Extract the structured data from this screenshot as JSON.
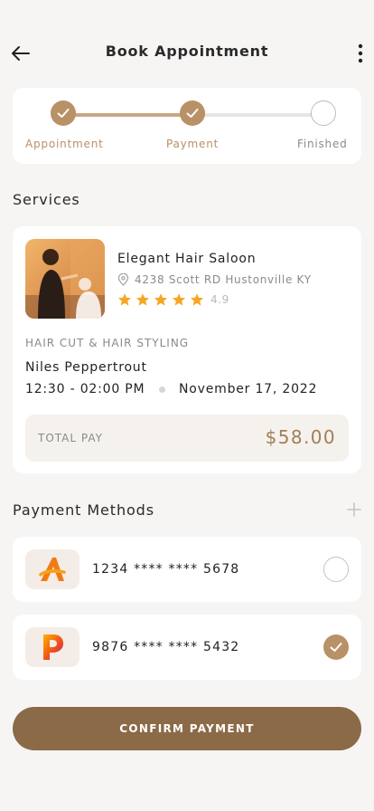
{
  "header": {
    "title": "Book Appointment"
  },
  "steps": [
    {
      "label": "Appointment",
      "status": "done"
    },
    {
      "label": "Payment",
      "status": "done"
    },
    {
      "label": "Finished",
      "status": "pending"
    }
  ],
  "services": {
    "section_title": "Services",
    "salon_name": "Elegant Hair Saloon",
    "address": "4238 Scott RD Hustonville KY",
    "rating_stars": 5,
    "rating_value": "4.9",
    "service_type": "HAIR CUT & HAIR STYLING",
    "client_name": "Niles Peppertrout",
    "time": "12:30 - 02:00 PM",
    "date": "November 17, 2022",
    "total_label": "TOTAL PAY",
    "total_value": "$58.00"
  },
  "payment": {
    "section_title": "Payment Methods",
    "methods": [
      {
        "logo": "A",
        "number": "1234 **** **** 5678",
        "selected": false
      },
      {
        "logo": "P",
        "number": "9876 **** **** 5432",
        "selected": true
      }
    ]
  },
  "confirm_label": "CONFIRM PAYMENT",
  "colors": {
    "accent": "#b89166",
    "button": "#8b6a47",
    "background": "#f6f5f4"
  }
}
